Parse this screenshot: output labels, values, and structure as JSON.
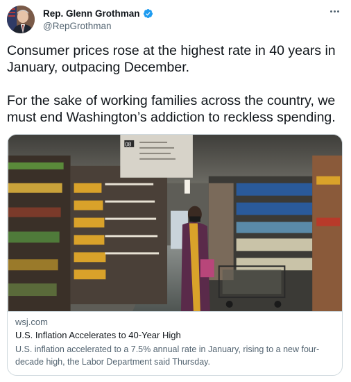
{
  "author": {
    "display_name": "Rep. Glenn Grothman",
    "handle": "@RepGrothman",
    "verified": true
  },
  "icons": {
    "verified": "verified-badge-icon",
    "more": "more-options-icon"
  },
  "tweet": {
    "paragraphs": [
      "Consumer prices rose at the highest rate in 40 years in January, outpacing December.",
      "For the sake of working families across the country, we must end Washington’s addiction to reckless spending."
    ]
  },
  "card": {
    "domain": "wsj.com",
    "title": "U.S. Inflation Accelerates to 40-Year High",
    "description": "U.S. inflation accelerated to a 7.5% annual rate in January, rising to a new four-decade high, the Labor Department said Thursday.",
    "image": {
      "aisle_sign_number": "08"
    }
  },
  "colors": {
    "text_primary": "#0f1419",
    "text_secondary": "#536471",
    "verified_blue": "#1d9bf0",
    "border": "#cfd9de"
  }
}
